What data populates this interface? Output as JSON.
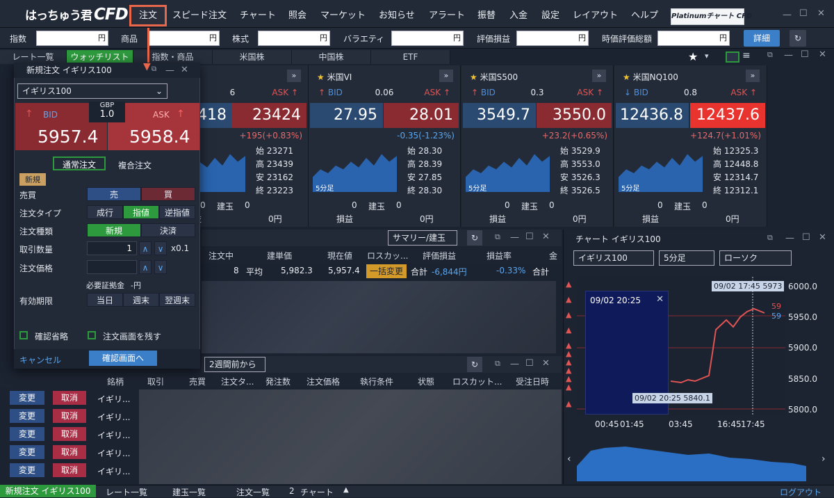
{
  "app": {
    "logo_text": "はっちゅう君",
    "logo_brand": "CFD",
    "platinum_label": "Platinumチャート CFD"
  },
  "nav": {
    "items": [
      "注文",
      "スピード注文",
      "チャート",
      "照会",
      "マーケット",
      "お知らせ",
      "アラート",
      "振替",
      "入金",
      "設定",
      "レイアウト",
      "ヘルプ"
    ]
  },
  "account": {
    "labels": [
      "指数",
      "商品",
      "株式",
      "バラエティ",
      "評価損益",
      "時価評価総額"
    ],
    "unit": "円",
    "detail": "詳細"
  },
  "tabs": [
    "レート一覧",
    "ウォッチリスト",
    "指数・商品",
    "米国株",
    "中国株",
    "ETF"
  ],
  "panels": [
    {
      "name": "",
      "spread": "6",
      "bid": "418",
      "ask": "23424",
      "change": "+195(+0.83%)",
      "change_color": "#e86a6a",
      "o": "始 23271",
      "h": "高 23439",
      "l": "安 23162",
      "c": "終 23223",
      "pos": "0",
      "pos_label": "建玉",
      "pos2": "0",
      "pl_label": "損益",
      "pl": "0円",
      "up": true,
      "period": ""
    },
    {
      "name": "米国VI",
      "spread": "0.06",
      "bid": "27.95",
      "ask": "28.01",
      "change": "-0.35(-1.23%)",
      "change_color": "#5aa7f0",
      "o": "始 28.30",
      "h": "高 28.39",
      "l": "安 27.85",
      "c": "終 28.30",
      "pos": "0",
      "pos_label": "建玉",
      "pos2": "0",
      "pl_label": "損益",
      "pl": "0円",
      "up": true,
      "period": "5分足"
    },
    {
      "name": "米国S500",
      "spread": "0.3",
      "bid": "3549.7",
      "ask": "3550.0",
      "change": "+23.2(+0.65%)",
      "change_color": "#e86a6a",
      "o": "始 3529.9",
      "h": "高 3553.0",
      "l": "安 3526.3",
      "c": "終 3526.5",
      "pos": "0",
      "pos_label": "建玉",
      "pos2": "0",
      "pl_label": "損益",
      "pl": "0円",
      "up": true,
      "period": "5分足"
    },
    {
      "name": "米国NQ100",
      "spread": "0.8",
      "bid": "12436.8",
      "ask": "12437.6",
      "change": "+124.7(+1.01%)",
      "change_color": "#e86a6a",
      "o": "始 12325.3",
      "h": "高 12448.8",
      "l": "安 12314.7",
      "c": "終 12312.1",
      "pos": "0",
      "pos_label": "建玉",
      "pos2": "0",
      "pl_label": "損益",
      "pl": "0円",
      "up": false,
      "period": "5分足"
    }
  ],
  "bidask": {
    "bid": "BID",
    "ask": "ASK"
  },
  "positions": {
    "summary_select": "サマリー/建玉",
    "headers": [
      "注文中",
      "建単価",
      "現在値",
      "ロスカッ...",
      "評価損益",
      "損益率",
      "金"
    ],
    "row": {
      "count": "8",
      "avg_label": "平均",
      "entry": "5,982.3",
      "current": "5,957.4",
      "bulk": "一括変更",
      "total_label": "合計",
      "pl": "-6,844円",
      "rate": "-0.33%",
      "total2": "合計"
    }
  },
  "orders": {
    "range_select": "2週間前から",
    "headers": [
      "銘柄",
      "取引",
      "売買",
      "注文タ...",
      "発注数",
      "注文価格",
      "執行条件",
      "状態",
      "ロスカット...",
      "受注日時"
    ],
    "change": "変更",
    "cancel": "取消",
    "symbol": "イギリ..."
  },
  "chart": {
    "title": "チャート イギリス100",
    "symbol": "イギリス100",
    "period": "5分足",
    "type": "ローソク",
    "price_label": "09/02 17:45 5973",
    "tooltip_time": "09/02 20:25",
    "bottom_label": "09/02 20:25 5840.1",
    "yticks": [
      "6000.0",
      "5950.0",
      "5900.0",
      "5850.0",
      "5800.0"
    ],
    "xticks": [
      "00:45",
      "01:45",
      "03:45",
      "16:45",
      "17:45"
    ],
    "right_tags": [
      "59",
      "59"
    ]
  },
  "dialog": {
    "title": "新規注文 イギリス100",
    "symbol": "イギリス100",
    "spread_cur": "GBP",
    "spread": "1.0",
    "bid": "5957.4",
    "ask": "5958.4",
    "tab_normal": "通常注文",
    "tab_complex": "複合注文",
    "tag": "新規",
    "label_side": "売買",
    "sell": "売",
    "buy": "買",
    "label_type": "注文タイプ",
    "type_opts": [
      "成行",
      "指値",
      "逆指値"
    ],
    "label_kind": "注文種類",
    "kind_opts": [
      "新規",
      "決済"
    ],
    "label_qty": "取引数量",
    "qty": "1",
    "qty_unit": "x0.1",
    "label_price": "注文価格",
    "margin_label": "必要証拠金",
    "margin": "-円",
    "label_expiry": "有効期限",
    "expiry_opts": [
      "当日",
      "週末",
      "翌週末"
    ],
    "skip_confirm": "確認省略",
    "keep_window": "注文画面を残す",
    "cancel": "キャンセル",
    "confirm": "確認画面へ"
  },
  "bottombar": {
    "active": "新規注文 イギリス100",
    "items": [
      "レート一覧",
      "建玉一覧",
      "注文一覧"
    ],
    "chart_count": "2",
    "chart_label": "チャート",
    "logout": "ログアウト"
  },
  "colors": {
    "accent_green": "#2e9a3e",
    "bid_blue": "#2a4a72",
    "ask_red": "#8a2b31",
    "highlight": "#e8674a"
  }
}
